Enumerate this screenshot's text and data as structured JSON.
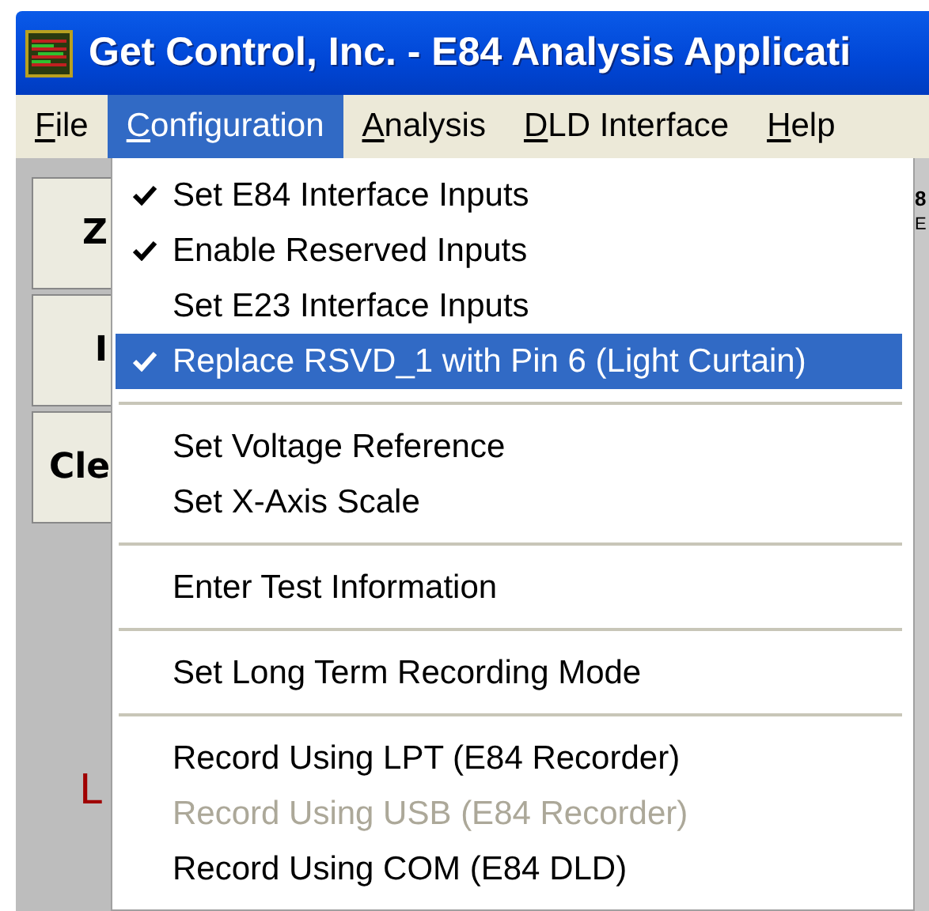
{
  "window": {
    "title": "Get Control, Inc. - E84 Analysis Applicati"
  },
  "menu_bar": [
    {
      "label": "File",
      "selected": false
    },
    {
      "label": "Configuration",
      "selected": true
    },
    {
      "label": "Analysis",
      "selected": false
    },
    {
      "label": "DLD Interface",
      "selected": false
    },
    {
      "label": "Help",
      "selected": false
    }
  ],
  "background": {
    "buttons": [
      "Z",
      "I",
      "Cle"
    ],
    "left_label": "L",
    "right_texts": [
      "8",
      "E"
    ]
  },
  "dropdown": [
    {
      "kind": "item",
      "label": "Set E84 Interface Inputs",
      "checked": true,
      "selected": false,
      "disabled": false
    },
    {
      "kind": "item",
      "label": "Enable Reserved Inputs",
      "checked": true,
      "selected": false,
      "disabled": false
    },
    {
      "kind": "item",
      "label": "Set E23 Interface Inputs",
      "checked": false,
      "selected": false,
      "disabled": false
    },
    {
      "kind": "item",
      "label": "Replace RSVD_1 with Pin 6 (Light Curtain)",
      "checked": true,
      "selected": true,
      "disabled": false
    },
    {
      "kind": "separator"
    },
    {
      "kind": "item",
      "label": "Set Voltage Reference",
      "checked": false,
      "selected": false,
      "disabled": false
    },
    {
      "kind": "item",
      "label": "Set X-Axis Scale",
      "checked": false,
      "selected": false,
      "disabled": false
    },
    {
      "kind": "separator"
    },
    {
      "kind": "item",
      "label": "Enter Test Information",
      "checked": false,
      "selected": false,
      "disabled": false
    },
    {
      "kind": "separator"
    },
    {
      "kind": "item",
      "label": "Set Long Term Recording Mode",
      "checked": false,
      "selected": false,
      "disabled": false
    },
    {
      "kind": "separator"
    },
    {
      "kind": "item",
      "label": "Record Using LPT (E84 Recorder)",
      "checked": false,
      "selected": false,
      "disabled": false
    },
    {
      "kind": "item",
      "label": "Record Using USB (E84 Recorder)",
      "checked": false,
      "selected": false,
      "disabled": true
    },
    {
      "kind": "item",
      "label": "Record Using COM (E84 DLD)",
      "checked": false,
      "selected": false,
      "disabled": false
    }
  ]
}
